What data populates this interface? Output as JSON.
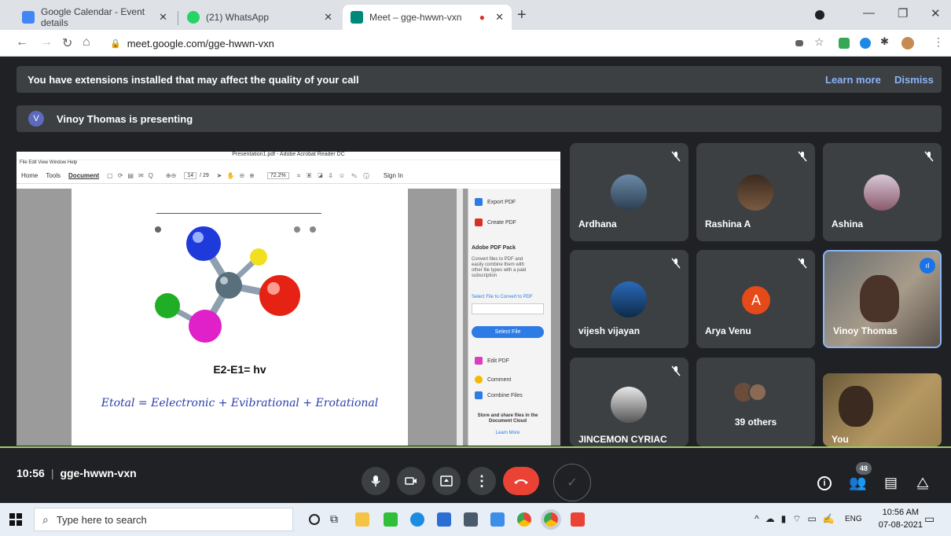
{
  "browser": {
    "tabs": [
      {
        "title": "Google Calendar - Event details",
        "favicon_color": "#4285f4"
      },
      {
        "title": "(21) WhatsApp",
        "favicon_color": "#25d366"
      },
      {
        "title": "Meet – gge-hwwn-vxn",
        "favicon_color": "#00897b"
      }
    ],
    "url": "meet.google.com/gge-hwwn-vxn"
  },
  "meet": {
    "ext_banner": "You have extensions installed that may affect the quality of your call",
    "learn_more": "Learn more",
    "dismiss": "Dismiss",
    "presenter_initial": "V",
    "presenting_text": "Vinoy Thomas is presenting",
    "meeting_time": "10:56",
    "meeting_code": "gge-hwwn-vxn",
    "participant_count": "48"
  },
  "acrobat": {
    "title": "Presentation1.pdf - Adobe Acrobat Reader DC",
    "menu": "File  Edit  View  Window  Help",
    "tools": [
      "Home",
      "Tools",
      "Document"
    ],
    "page_num": "14",
    "page_total": "/ 29",
    "zoom": "72.2%",
    "sign_in": "Sign In",
    "formula1": "E2-E1= hv",
    "formula2": "Etotal = Eelectronic + Evibrational + Erotational",
    "panel": {
      "export": "Export PDF",
      "create": "Create PDF",
      "pack_title": "Adobe PDF Pack",
      "pack_desc": "Convert files to PDF and easily combine them with other file types with a paid subscription",
      "select_label": "Select File to Convert to PDF",
      "select_btn": "Select File",
      "edit": "Edit PDF",
      "comment": "Comment",
      "combine": "Combine Files",
      "store": "Store and share files in the Document Cloud",
      "learn": "Learn More"
    }
  },
  "participants": [
    {
      "name": "Ardhana",
      "muted": true
    },
    {
      "name": "Rashina A",
      "muted": true
    },
    {
      "name": "Ashina",
      "muted": true
    },
    {
      "name": "vijesh vijayan",
      "muted": true
    },
    {
      "name": "Arya Venu",
      "initial": "A",
      "avatar_color": "#e64a19",
      "muted": true
    },
    {
      "name": "Vinoy Thomas",
      "speaking": true
    },
    {
      "name": "JINCEMON CYRIAC",
      "muted": true
    },
    {
      "name": "39 others"
    },
    {
      "name": "You"
    }
  ],
  "taskbar": {
    "search_placeholder": "Type here to search",
    "lang": "ENG",
    "time": "10:56 AM",
    "date": "07-08-2021"
  }
}
